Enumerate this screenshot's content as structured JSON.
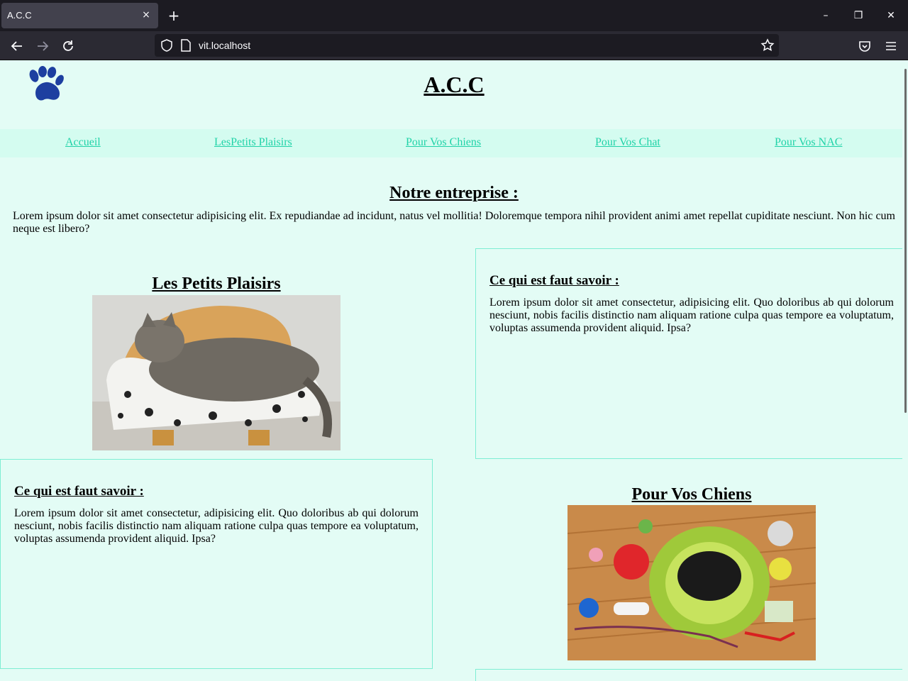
{
  "browser": {
    "tab_title": "A.C.C",
    "tab_close": "×",
    "new_tab": "+",
    "url": "vit.localhost",
    "window_minimize": "–",
    "window_restore": "❐",
    "window_close": "✕"
  },
  "site": {
    "title": "A.C.C",
    "logo_icon": "paw-print-icon",
    "accent_color": "#20d3a8",
    "background_color": "#e3fcf5"
  },
  "menu": {
    "items": [
      {
        "label": "Accueil"
      },
      {
        "label": "LesPetits Plaisirs"
      },
      {
        "label": "Pour Vos Chiens"
      },
      {
        "label": "Pour Vos Chat"
      },
      {
        "label": "Pour Vos NAC"
      }
    ]
  },
  "about": {
    "title": "Notre entreprise :",
    "text": "Lorem ipsum dolor sit amet consectetur adipisicing elit. Ex repudiandae ad incidunt, natus vel mollitia! Doloremque tempora nihil provident animi amet repellat cupiditate nesciunt. Non hic cum neque est libero?"
  },
  "cards": [
    {
      "title": "Les Petits Plaisirs",
      "info_title": "Ce qui est faut savoir :",
      "info_text": "Lorem ipsum dolor sit amet consectetur, adipisicing elit. Quo doloribus ab qui dolorum nesciunt, nobis facilis distinctio nam aliquam ratione culpa quas tempore ea voluptatum, voluptas assumenda provident aliquid. Ipsa?"
    },
    {
      "title": "Pour Vos Chiens",
      "info_title": "Ce qui est faut savoir :",
      "info_text": "Lorem ipsum dolor sit amet consectetur, adipisicing elit. Quo doloribus ab qui dolorum nesciunt, nobis facilis distinctio nam aliquam ratione culpa quas tempore ea voluptatum, voluptas assumenda provident aliquid. Ipsa?"
    }
  ]
}
